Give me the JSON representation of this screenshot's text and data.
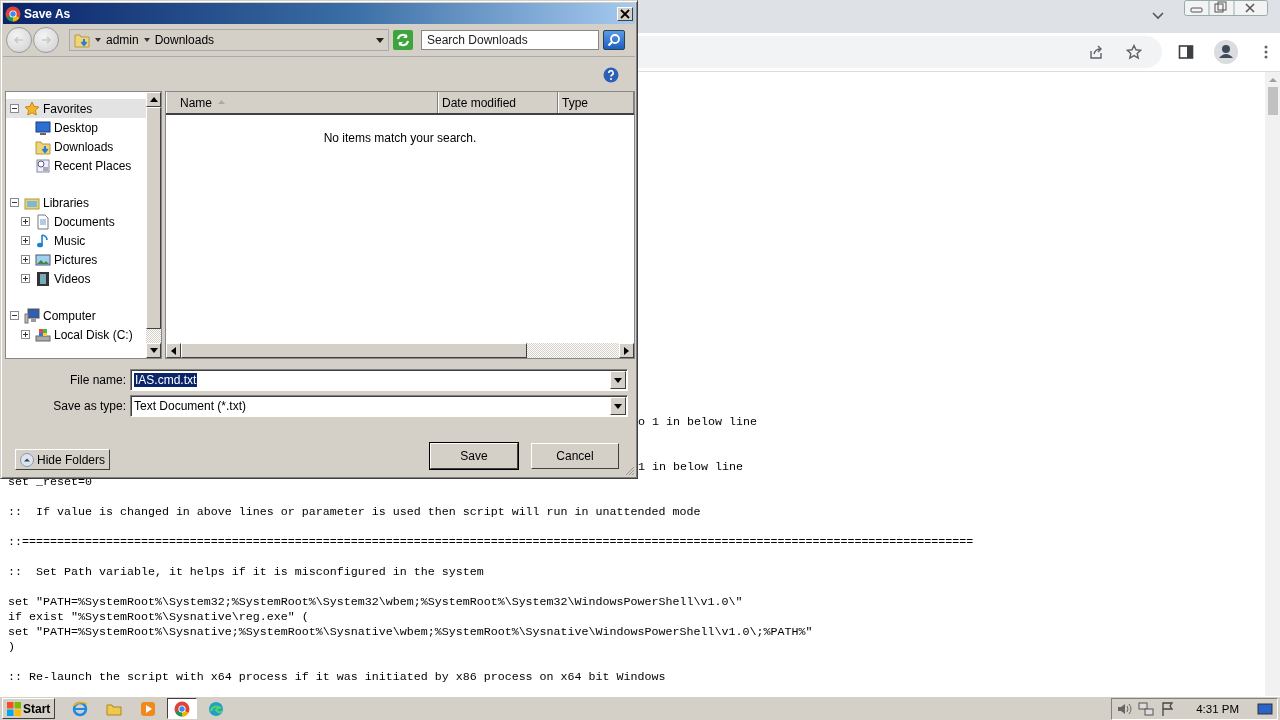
{
  "dialog": {
    "title": "Save As",
    "breadcrumbs": [
      "admin",
      "Downloads"
    ],
    "search": {
      "placeholder": "Search Downloads"
    },
    "tree": [
      {
        "label": "Favorites",
        "expanded": true,
        "selected": true,
        "children": [
          {
            "label": "Desktop",
            "selected": false
          },
          {
            "label": "Downloads",
            "selected": false
          },
          {
            "label": "Recent Places",
            "selected": false
          }
        ]
      },
      {
        "label": "Libraries",
        "expanded": true,
        "selected": false,
        "children": [
          {
            "label": "Documents",
            "expanded": false,
            "selected": false
          },
          {
            "label": "Music",
            "expanded": false,
            "selected": false
          },
          {
            "label": "Pictures",
            "expanded": false,
            "selected": false
          },
          {
            "label": "Videos",
            "expanded": false,
            "selected": false
          }
        ]
      },
      {
        "label": "Computer",
        "expanded": true,
        "selected": false,
        "children": [
          {
            "label": "Local Disk (C:)",
            "expanded": false,
            "selected": false
          }
        ]
      }
    ],
    "columns": [
      {
        "label": "Name",
        "sorted": true
      },
      {
        "label": "Date modified",
        "sorted": false
      },
      {
        "label": "Type",
        "sorted": false
      }
    ],
    "empty_message": "No items match your search.",
    "file_name": {
      "label": "File name:",
      "value": "IAS.cmd.txt",
      "highlighted": true
    },
    "save_type": {
      "label": "Save as type:",
      "value": "Text Document (*.txt)"
    },
    "hide_folders": "Hide Folders",
    "buttons": [
      {
        "label": "Save",
        "default": true
      },
      {
        "label": "Cancel",
        "default": false
      }
    ]
  },
  "document": {
    "lines": [
      {
        "kind": "tail",
        "text": "o 1 in below line"
      },
      {
        "kind": "blank"
      },
      {
        "kind": "blank"
      },
      {
        "kind": "tail",
        "text": "1 in below line"
      },
      {
        "kind": "line",
        "text": "set _reset=0"
      },
      {
        "kind": "blank"
      },
      {
        "kind": "line",
        "text": "::  If value is changed in above lines or parameter is used then script will run in unattended mode"
      },
      {
        "kind": "blank"
      },
      {
        "kind": "line",
        "text": "::========================================================================================================================================"
      },
      {
        "kind": "blank"
      },
      {
        "kind": "line",
        "text": "::  Set Path variable, it helps if it is misconfigured in the system"
      },
      {
        "kind": "blank"
      },
      {
        "kind": "line",
        "text": "set \"PATH=%SystemRoot%\\System32;%SystemRoot%\\System32\\wbem;%SystemRoot%\\System32\\WindowsPowerShell\\v1.0\\\""
      },
      {
        "kind": "line",
        "text": "if exist \"%SystemRoot%\\Sysnative\\reg.exe\" ("
      },
      {
        "kind": "line",
        "text": "set \"PATH=%SystemRoot%\\Sysnative;%SystemRoot%\\Sysnative\\wbem;%SystemRoot%\\Sysnative\\WindowsPowerShell\\v1.0\\;%PATH%\""
      },
      {
        "kind": "line",
        "text": ")"
      },
      {
        "kind": "blank"
      },
      {
        "kind": "line",
        "text": ":: Re-launch the script with x64 process if it was initiated by x86 process on x64 bit Windows"
      }
    ]
  },
  "taskbar": {
    "start": "Start",
    "time": "4:31 PM",
    "apps": [
      {
        "selected": false
      },
      {
        "selected": false
      },
      {
        "selected": false
      },
      {
        "selected": true
      },
      {
        "selected": false
      }
    ]
  }
}
